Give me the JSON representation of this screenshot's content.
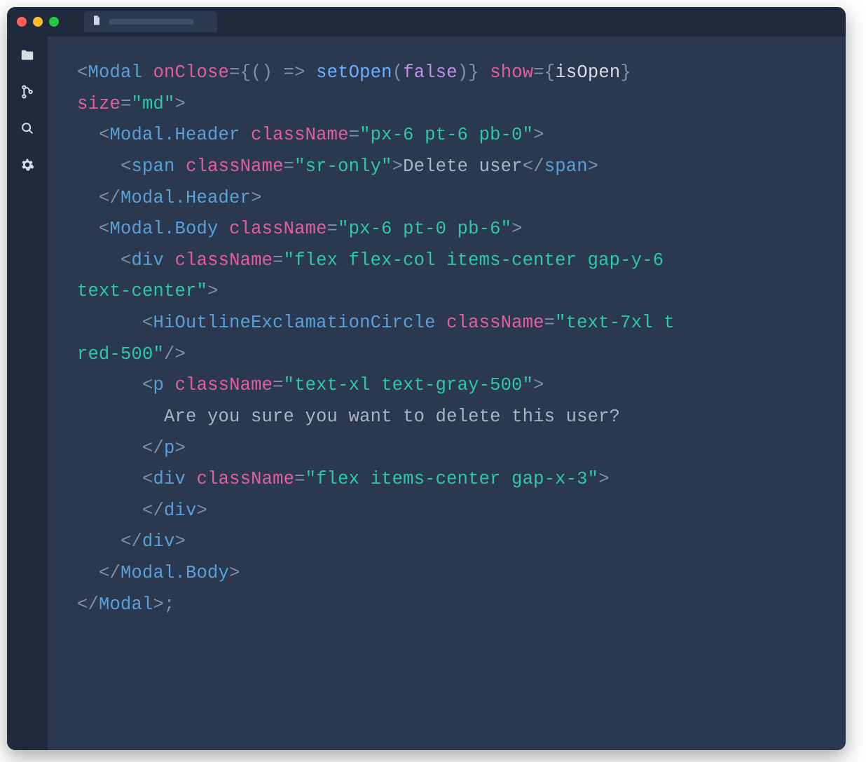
{
  "colors": {
    "window_bg": "#2b3950",
    "chrome_bg": "#1f2a3c",
    "punc": "#7f90ab",
    "tag": "#5aa0d8",
    "attr": "#e35ea0",
    "string": "#2fc8a6",
    "fn": "#6ab0ff",
    "keyword": "#c18fe8",
    "ident": "#d6dbe6",
    "text": "#a8b5c9"
  },
  "titlebar": {
    "traffic_lights": [
      "close",
      "minimize",
      "zoom"
    ]
  },
  "activitybar": {
    "items": [
      "explorer",
      "source-control",
      "search",
      "settings"
    ]
  },
  "code": {
    "lines": [
      [
        {
          "t": "<",
          "c": "punc"
        },
        {
          "t": "Modal",
          "c": "tag"
        },
        {
          "t": " ",
          "c": "text"
        },
        {
          "t": "onClose",
          "c": "attr"
        },
        {
          "t": "=",
          "c": "punc"
        },
        {
          "t": "{",
          "c": "punc"
        },
        {
          "t": "()",
          "c": "punc"
        },
        {
          "t": " ",
          "c": "text"
        },
        {
          "t": "=>",
          "c": "punc"
        },
        {
          "t": " ",
          "c": "text"
        },
        {
          "t": "setOpen",
          "c": "fn"
        },
        {
          "t": "(",
          "c": "punc"
        },
        {
          "t": "false",
          "c": "kw"
        },
        {
          "t": ")",
          "c": "punc"
        },
        {
          "t": "}",
          "c": "punc"
        },
        {
          "t": " ",
          "c": "text"
        },
        {
          "t": "show",
          "c": "attr"
        },
        {
          "t": "=",
          "c": "punc"
        },
        {
          "t": "{",
          "c": "punc"
        },
        {
          "t": "isOpen",
          "c": "ident"
        },
        {
          "t": "}",
          "c": "punc"
        },
        {
          "t": " ",
          "c": "text"
        }
      ],
      [
        {
          "t": "size",
          "c": "attr"
        },
        {
          "t": "=",
          "c": "punc"
        },
        {
          "t": "\"md\"",
          "c": "str"
        },
        {
          "t": ">",
          "c": "punc"
        }
      ],
      [
        {
          "t": "  ",
          "c": "text"
        },
        {
          "t": "<",
          "c": "punc"
        },
        {
          "t": "Modal.Header",
          "c": "tag"
        },
        {
          "t": " ",
          "c": "text"
        },
        {
          "t": "className",
          "c": "attr"
        },
        {
          "t": "=",
          "c": "punc"
        },
        {
          "t": "\"px-6 pt-6 pb-0\"",
          "c": "str"
        },
        {
          "t": ">",
          "c": "punc"
        }
      ],
      [
        {
          "t": "    ",
          "c": "text"
        },
        {
          "t": "<",
          "c": "punc"
        },
        {
          "t": "span",
          "c": "tag"
        },
        {
          "t": " ",
          "c": "text"
        },
        {
          "t": "className",
          "c": "attr"
        },
        {
          "t": "=",
          "c": "punc"
        },
        {
          "t": "\"sr-only\"",
          "c": "str"
        },
        {
          "t": ">",
          "c": "punc"
        },
        {
          "t": "Delete user",
          "c": "text"
        },
        {
          "t": "</",
          "c": "punc"
        },
        {
          "t": "span",
          "c": "tag"
        },
        {
          "t": ">",
          "c": "punc"
        }
      ],
      [
        {
          "t": "  ",
          "c": "text"
        },
        {
          "t": "</",
          "c": "punc"
        },
        {
          "t": "Modal.Header",
          "c": "tag"
        },
        {
          "t": ">",
          "c": "punc"
        }
      ],
      [
        {
          "t": "  ",
          "c": "text"
        },
        {
          "t": "<",
          "c": "punc"
        },
        {
          "t": "Modal.Body",
          "c": "tag"
        },
        {
          "t": " ",
          "c": "text"
        },
        {
          "t": "className",
          "c": "attr"
        },
        {
          "t": "=",
          "c": "punc"
        },
        {
          "t": "\"px-6 pt-0 pb-6\"",
          "c": "str"
        },
        {
          "t": ">",
          "c": "punc"
        }
      ],
      [
        {
          "t": "    ",
          "c": "text"
        },
        {
          "t": "<",
          "c": "punc"
        },
        {
          "t": "div",
          "c": "tag"
        },
        {
          "t": " ",
          "c": "text"
        },
        {
          "t": "className",
          "c": "attr"
        },
        {
          "t": "=",
          "c": "punc"
        },
        {
          "t": "\"flex flex-col items-center gap-y-6 ",
          "c": "str"
        }
      ],
      [
        {
          "t": "text-center\"",
          "c": "str"
        },
        {
          "t": ">",
          "c": "punc"
        }
      ],
      [
        {
          "t": "      ",
          "c": "text"
        },
        {
          "t": "<",
          "c": "punc"
        },
        {
          "t": "HiOutlineExclamationCircle",
          "c": "tag"
        },
        {
          "t": " ",
          "c": "text"
        },
        {
          "t": "className",
          "c": "attr"
        },
        {
          "t": "=",
          "c": "punc"
        },
        {
          "t": "\"text-7xl t",
          "c": "str"
        }
      ],
      [
        {
          "t": "red-500\"",
          "c": "str"
        },
        {
          "t": "/>",
          "c": "punc"
        }
      ],
      [
        {
          "t": "      ",
          "c": "text"
        },
        {
          "t": "<",
          "c": "punc"
        },
        {
          "t": "p",
          "c": "tag"
        },
        {
          "t": " ",
          "c": "text"
        },
        {
          "t": "className",
          "c": "attr"
        },
        {
          "t": "=",
          "c": "punc"
        },
        {
          "t": "\"text-xl text-gray-500\"",
          "c": "str"
        },
        {
          "t": ">",
          "c": "punc"
        }
      ],
      [
        {
          "t": "        Are you sure you want to delete this user?",
          "c": "text"
        }
      ],
      [
        {
          "t": "      ",
          "c": "text"
        },
        {
          "t": "</",
          "c": "punc"
        },
        {
          "t": "p",
          "c": "tag"
        },
        {
          "t": ">",
          "c": "punc"
        }
      ],
      [
        {
          "t": "      ",
          "c": "text"
        },
        {
          "t": "<",
          "c": "punc"
        },
        {
          "t": "div",
          "c": "tag"
        },
        {
          "t": " ",
          "c": "text"
        },
        {
          "t": "className",
          "c": "attr"
        },
        {
          "t": "=",
          "c": "punc"
        },
        {
          "t": "\"flex items-center gap-x-3\"",
          "c": "str"
        },
        {
          "t": ">",
          "c": "punc"
        }
      ],
      [
        {
          "t": "      ",
          "c": "text"
        },
        {
          "t": "</",
          "c": "punc"
        },
        {
          "t": "div",
          "c": "tag"
        },
        {
          "t": ">",
          "c": "punc"
        }
      ],
      [
        {
          "t": "    ",
          "c": "text"
        },
        {
          "t": "</",
          "c": "punc"
        },
        {
          "t": "div",
          "c": "tag"
        },
        {
          "t": ">",
          "c": "punc"
        }
      ],
      [
        {
          "t": "  ",
          "c": "text"
        },
        {
          "t": "</",
          "c": "punc"
        },
        {
          "t": "Modal.Body",
          "c": "tag"
        },
        {
          "t": ">",
          "c": "punc"
        }
      ],
      [
        {
          "t": "</",
          "c": "punc"
        },
        {
          "t": "Modal",
          "c": "tag"
        },
        {
          "t": ">",
          "c": "punc"
        },
        {
          "t": ";",
          "c": "punc"
        }
      ]
    ]
  }
}
